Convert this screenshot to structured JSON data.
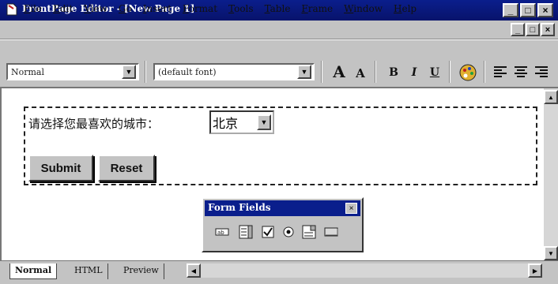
{
  "window": {
    "title": "FrontPage Editor - [New Page 1]",
    "min_glyph": "_",
    "max_glyph": "□",
    "close_glyph": "×"
  },
  "menu": {
    "items": [
      "File",
      "Edit",
      "View",
      "Go",
      "Insert",
      "Format",
      "Tools",
      "Table",
      "Frame",
      "Window",
      "Help"
    ]
  },
  "toolbar": {
    "style_value": "Normal",
    "font_value": "(default font)",
    "increase_text_label": "A",
    "decrease_text_label": "A",
    "bold_label": "B",
    "italic_label": "I",
    "underline_label": "U"
  },
  "form": {
    "prompt": "请选择您最喜欢的城市：",
    "select_value": "北京",
    "submit_label": "Submit",
    "reset_label": "Reset"
  },
  "palette": {
    "title": "Form Fields",
    "tools": [
      "one-line-textbox-icon",
      "scrolling-textbox-icon",
      "checkbox-icon",
      "radio-button-icon",
      "dropdown-menu-icon",
      "push-button-icon"
    ]
  },
  "view_tabs": [
    "Normal",
    "HTML",
    "Preview"
  ],
  "colors": {
    "titlebar": "#0a1e8c",
    "chrome": "#c3c3c3",
    "canvas": "#ffffff"
  }
}
